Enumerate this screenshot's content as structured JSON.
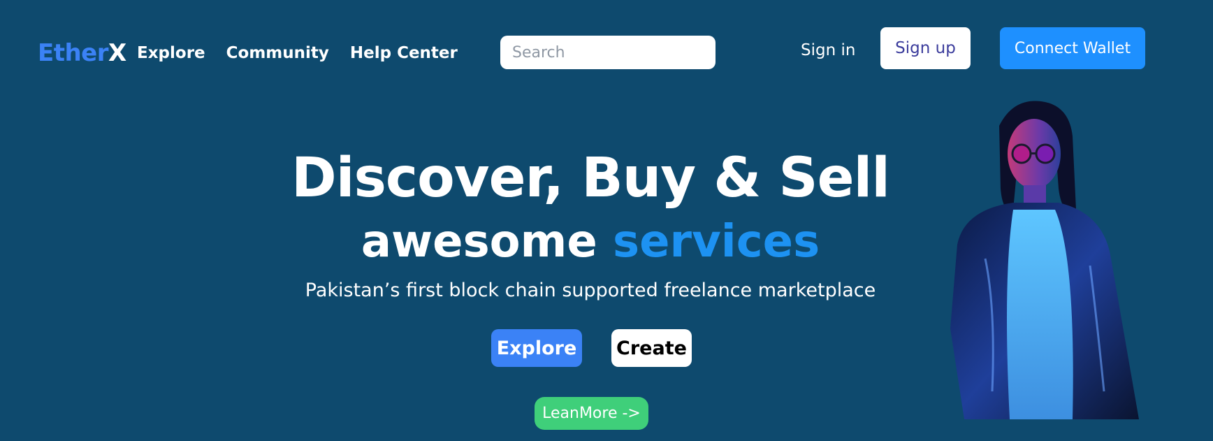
{
  "header": {
    "logo_part1": "Ether",
    "logo_part2": "X",
    "nav": [
      "Explore",
      "Community",
      "Help Center"
    ],
    "search_placeholder": "Search",
    "signin_label": "Sign in",
    "signup_label": "Sign up",
    "wallet_label": "Connect Wallet"
  },
  "hero": {
    "headline": "Discover, Buy & Sell",
    "subheadline_part1": "awesome",
    "subheadline_part2": "services",
    "tagline": "Pakistan’s first block chain supported freelance marketplace",
    "explore_label": "Explore",
    "create_label": "Create",
    "learnmore_label": "LeanMore ->"
  },
  "colors": {
    "background": "#0e4a6e",
    "accent_blue": "#1d92f2",
    "logo_blue": "#3b82f6",
    "explore_button": "#3b82f6",
    "wallet_button": "#1e90ff",
    "learnmore_button": "#3fcf7a"
  }
}
